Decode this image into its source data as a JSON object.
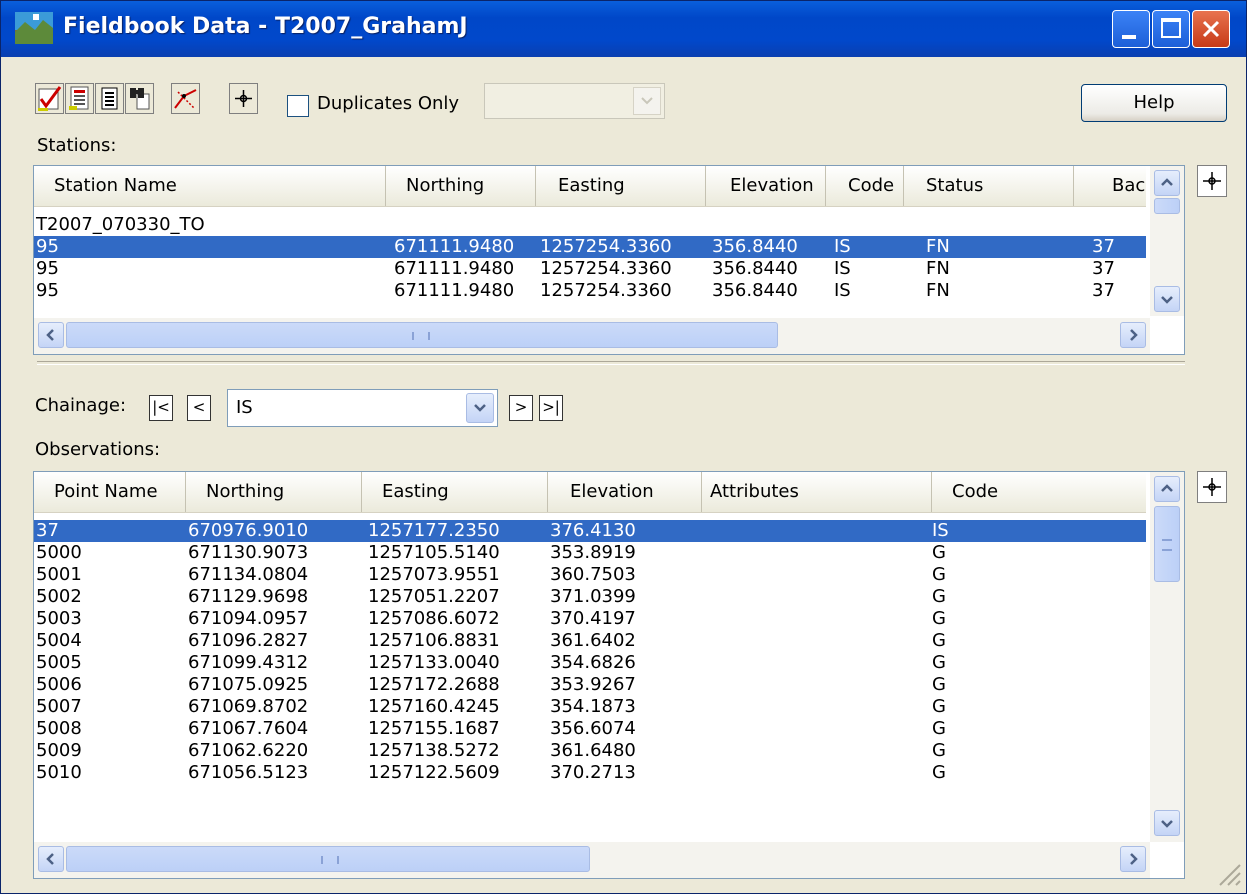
{
  "window": {
    "title": "Fieldbook Data - T2007_GrahamJ"
  },
  "toolbar": {
    "buttons": [
      "edit-check-icon",
      "report-icon",
      "list-icon",
      "find-icon",
      "traverse-icon",
      "locate-icon"
    ],
    "duplicates_label": "Duplicates Only",
    "duplicates_checked": false,
    "help_label": "Help"
  },
  "stations": {
    "label": "Stations:",
    "columns": [
      "Station Name",
      "Northing",
      "Easting",
      "Elevation",
      "Code",
      "Status",
      "Bacl"
    ],
    "group_row": "T2007_070330_TO",
    "rows": [
      [
        "95",
        "671111.9480",
        "1257254.3360",
        "356.8440",
        "IS",
        "FN",
        "37"
      ],
      [
        "95",
        "671111.9480",
        "1257254.3360",
        "356.8440",
        "IS",
        "FN",
        "37"
      ],
      [
        "95",
        "671111.9480",
        "1257254.3360",
        "356.8440",
        "IS",
        "FN",
        "37"
      ]
    ],
    "selected_index": 0
  },
  "chainage": {
    "label": "Chainage:",
    "value": "IS"
  },
  "observations": {
    "label": "Observations:",
    "columns": [
      "Point Name",
      "Northing",
      "Easting",
      "Elevation",
      "Attributes",
      "Code"
    ],
    "rows": [
      [
        "37",
        "670976.9010",
        "1257177.2350",
        "376.4130",
        "",
        "IS"
      ],
      [
        "5000",
        "671130.9073",
        "1257105.5140",
        "353.8919",
        "",
        "G"
      ],
      [
        "5001",
        "671134.0804",
        "1257073.9551",
        "360.7503",
        "",
        "G"
      ],
      [
        "5002",
        "671129.9698",
        "1257051.2207",
        "371.0399",
        "",
        "G"
      ],
      [
        "5003",
        "671094.0957",
        "1257086.6072",
        "370.4197",
        "",
        "G"
      ],
      [
        "5004",
        "671096.2827",
        "1257106.8831",
        "361.6402",
        "",
        "G"
      ],
      [
        "5005",
        "671099.4312",
        "1257133.0040",
        "354.6826",
        "",
        "G"
      ],
      [
        "5006",
        "671075.0925",
        "1257172.2688",
        "353.9267",
        "",
        "G"
      ],
      [
        "5007",
        "671069.8702",
        "1257160.4245",
        "354.1873",
        "",
        "G"
      ],
      [
        "5008",
        "671067.7604",
        "1257155.1687",
        "356.6074",
        "",
        "G"
      ],
      [
        "5009",
        "671062.6220",
        "1257138.5272",
        "361.6480",
        "",
        "G"
      ],
      [
        "5010",
        "671056.5123",
        "1257122.5609",
        "370.2713",
        "",
        "G"
      ]
    ],
    "selected_index": 0
  },
  "colors": {
    "selection": "#316ac5",
    "titlebar": "#0148cb",
    "dialog": "#ece9d8"
  }
}
